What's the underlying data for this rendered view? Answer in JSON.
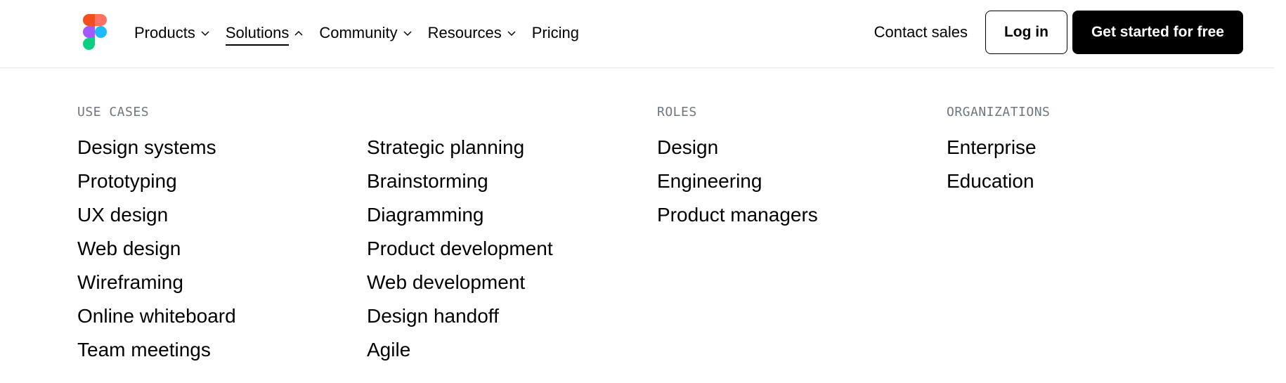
{
  "header": {
    "nav": [
      {
        "label": "Products",
        "has_chevron": true,
        "chevron": "chevron-down-icon"
      },
      {
        "label": "Solutions",
        "has_chevron": true,
        "chevron": "chevron-up-icon",
        "active": true
      },
      {
        "label": "Community",
        "has_chevron": true,
        "chevron": "chevron-down-icon"
      },
      {
        "label": "Resources",
        "has_chevron": true,
        "chevron": "chevron-down-icon"
      },
      {
        "label": "Pricing",
        "has_chevron": false
      }
    ],
    "contact_label": "Contact sales",
    "login_label": "Log in",
    "cta_label": "Get started for free"
  },
  "dropdown": {
    "use_cases": {
      "heading": "USE CASES",
      "items_col1": [
        "Design systems",
        "Prototyping",
        "UX design",
        "Web design",
        "Wireframing",
        "Online whiteboard",
        "Team meetings"
      ],
      "items_col2": [
        "Strategic planning",
        "Brainstorming",
        "Diagramming",
        "Product development",
        "Web development",
        "Design handoff",
        "Agile"
      ]
    },
    "roles": {
      "heading": "ROLES",
      "items": [
        "Design",
        "Engineering",
        "Product managers"
      ]
    },
    "organizations": {
      "heading": "ORGANIZATIONS",
      "items": [
        "Enterprise",
        "Education"
      ]
    }
  },
  "colors": {
    "text": "#000000",
    "heading": "#6e7781",
    "cta_bg": "#000000",
    "cta_text": "#ffffff",
    "logo_red": "#f24e1e",
    "logo_orange": "#ff7262",
    "logo_purple": "#a259ff",
    "logo_blue": "#1abcfe",
    "logo_green": "#0acf83"
  }
}
